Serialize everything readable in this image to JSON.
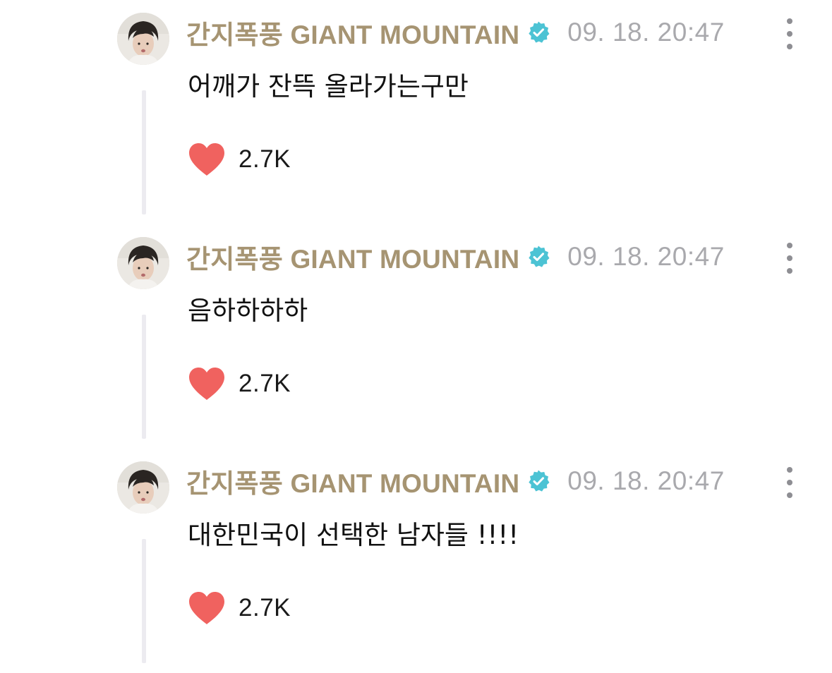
{
  "comments": [
    {
      "author": "간지폭풍 GIANT MOUNTAIN",
      "timestamp": "09. 18. 20:47",
      "text": "어깨가 잔뜩 올라가는구만",
      "likes": "2.7K"
    },
    {
      "author": "간지폭풍 GIANT MOUNTAIN",
      "timestamp": "09. 18. 20:47",
      "text": "음하하하하",
      "likes": "2.7K"
    },
    {
      "author": "간지폭풍 GIANT MOUNTAIN",
      "timestamp": "09. 18. 20:47",
      "text": "대한민국이 선택한 남자들 !!!!",
      "likes": "2.7K"
    }
  ],
  "icons": {
    "verified": "verified-badge-icon",
    "like": "heart-icon",
    "menu": "more-vertical-icon"
  },
  "colors": {
    "author": "#a69472",
    "timestamp": "#a9a9ad",
    "verified": "#4cc3d4",
    "heart": "#f0625f",
    "thread_line": "#ecebf0"
  }
}
